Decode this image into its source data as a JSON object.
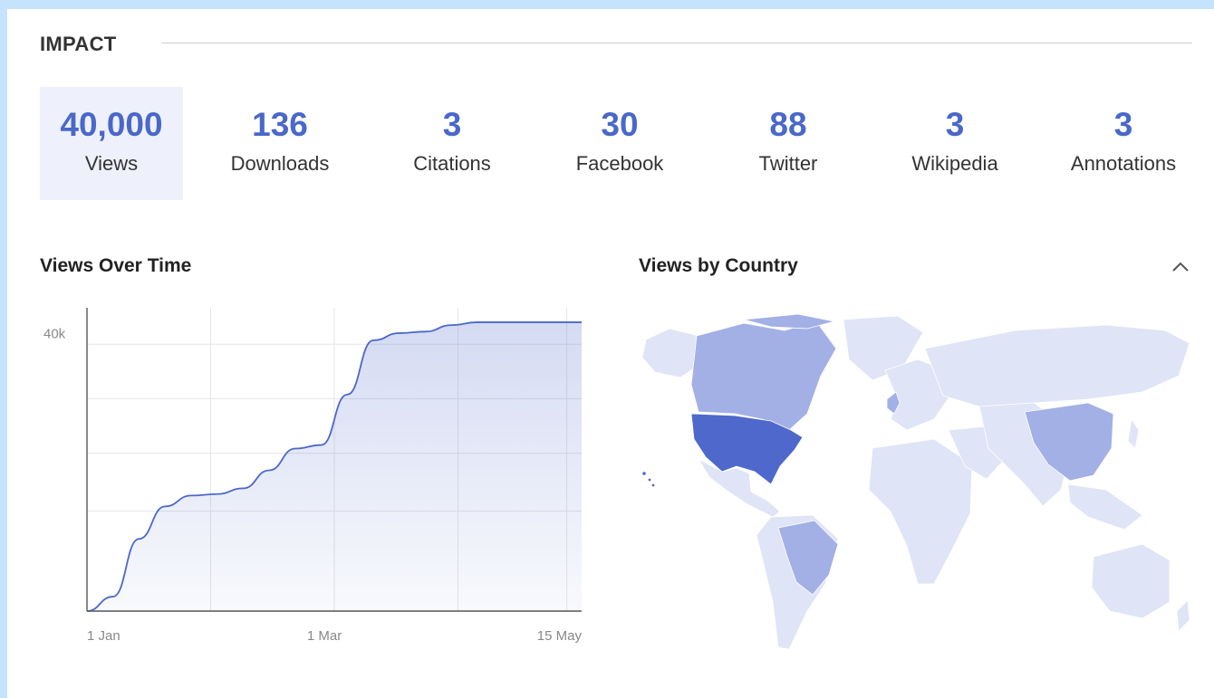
{
  "section": {
    "title": "IMPACT"
  },
  "metrics": [
    {
      "value": "40,000",
      "label": "Views",
      "active": true
    },
    {
      "value": "136",
      "label": "Downloads",
      "active": false
    },
    {
      "value": "3",
      "label": "Citations",
      "active": false
    },
    {
      "value": "30",
      "label": "Facebook",
      "active": false
    },
    {
      "value": "88",
      "label": "Twitter",
      "active": false
    },
    {
      "value": "3",
      "label": "Wikipedia",
      "active": false
    },
    {
      "value": "3",
      "label": "Annotations",
      "active": false
    }
  ],
  "views_over_time": {
    "title": "Views Over Time"
  },
  "views_by_country": {
    "title": "Views by Country",
    "collapse_icon": "chevron-up-icon"
  },
  "colors": {
    "accent": "#4a68c9",
    "map_high": "#4f68cc",
    "map_mid": "#a2b0e6",
    "map_low": "#dfe4f6"
  },
  "chart_data": {
    "type": "area",
    "title": "Views Over Time",
    "xlabel": "",
    "ylabel": "",
    "x_tick_labels": [
      "1 Jan",
      "1 Mar",
      "15 May"
    ],
    "y_tick_labels": [
      "40k"
    ],
    "x": [
      "1 Jan",
      "8 Jan",
      "15 Jan",
      "22 Jan",
      "29 Jan",
      "5 Feb",
      "12 Feb",
      "19 Feb",
      "26 Feb",
      "5 Mar",
      "12 Mar",
      "19 Mar",
      "26 Mar",
      "2 Apr",
      "9 Apr",
      "16 Apr",
      "23 Apr",
      "30 Apr",
      "7 May",
      "15 May"
    ],
    "values": [
      0,
      2000,
      10000,
      14500,
      16000,
      16200,
      17000,
      19500,
      22500,
      23000,
      30000,
      37500,
      38500,
      38700,
      39600,
      40000,
      40000,
      40000,
      40000,
      40000
    ],
    "ylim": [
      0,
      42000
    ],
    "grid": true
  },
  "map_data": {
    "high": [
      "United States"
    ],
    "medium": [
      "Canada",
      "Brazil",
      "China",
      "United Kingdom"
    ],
    "low": [
      "other countries"
    ]
  }
}
